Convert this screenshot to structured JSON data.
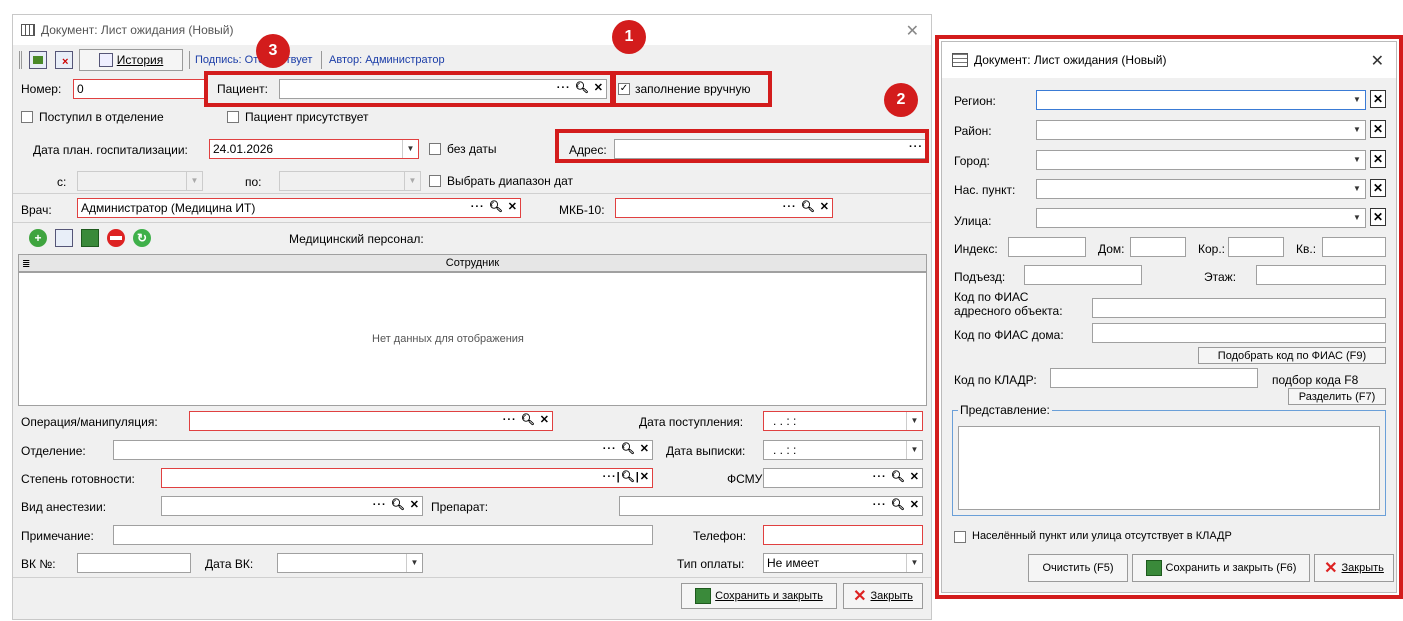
{
  "left": {
    "title": "Документ: Лист ожидания (Новый)",
    "toolbar": {
      "history_label": "История",
      "signature_label": "Подпись: Отс",
      "signature_rest": "твует",
      "author_label": "Автор: Администратор"
    },
    "number_label": "Номер:",
    "number_value": "0",
    "patient_label": "Пациент:",
    "manual_fill_label": "заполнение вручную",
    "admitted_label": "Поступил в отделение",
    "patient_present_label": "Пациент присутствует",
    "plan_date_label": "Дата план. госпитализации:",
    "plan_date_value": "24.01.2026",
    "no_date_label": "без даты",
    "address_label": "Адрес:",
    "from_label": "с:",
    "to_label": "по:",
    "date_range_label": "Выбрать диапазон дат",
    "doctor_label": "Врач:",
    "doctor_value": "Администратор (Медицина ИТ)",
    "mkb_label": "МКБ-10:",
    "med_staff_label": "Медицинский персонал:",
    "grid_column": "Сотрудник",
    "grid_empty": "Нет данных для отображения",
    "operation_label": "Операция/манипуляция:",
    "arrival_date_label": "Дата поступления:",
    "arrival_date_value": ". .     : :",
    "department_label": "Отделение:",
    "discharge_date_label": "Дата выписки:",
    "discharge_date_value": ". .     : :",
    "readiness_label": "Степень готовности:",
    "fsmu_label": "ФСМУ:",
    "anesthesia_label": "Вид анестезии:",
    "drug_label": "Препарат:",
    "note_label": "Примечание:",
    "phone_label": "Телефон:",
    "vk_num_label": "ВК №:",
    "vk_date_label": "Дата ВК:",
    "pay_type_label": "Тип оплаты:",
    "pay_type_value": "Не имеет",
    "save_close_label": "Сохранить и закрыть",
    "close_label": "Закрыть"
  },
  "right": {
    "title": "Документ: Лист ожидания (Новый)",
    "region_label": "Регион:",
    "district_label": "Район:",
    "city_label": "Город:",
    "locality_label": "Нас. пункт:",
    "street_label": "Улица:",
    "index_label": "Индекс:",
    "house_label": "Дом:",
    "korp_label": "Кор.:",
    "kv_label": "Кв.:",
    "entrance_label": "Подъезд:",
    "floor_label": "Этаж:",
    "fias_addr_label_1": "Код по ФИАС",
    "fias_addr_label_2": "адресного объекта:",
    "fias_house_label": "Код по ФИАС дома:",
    "pick_fias_label": "Подобрать код по ФИАС (F9)",
    "kladr_label": "Код по КЛАДР:",
    "pick_code_label": "подбор кода F8",
    "split_label": "Разделить (F7)",
    "presentation_label": "Представление:",
    "missing_kladr_label": "Населённый пункт или улица отсутствует в КЛАДР",
    "clear_label": "Очистить (F5)",
    "save_close_label": "Сохранить и закрыть (F6)",
    "close_label": "Закрыть"
  },
  "annotations": [
    "1",
    "2",
    "3"
  ],
  "colors": {
    "highlight": "#d31c1c",
    "required_border": "#e04040",
    "link": "#1c3ea8"
  }
}
